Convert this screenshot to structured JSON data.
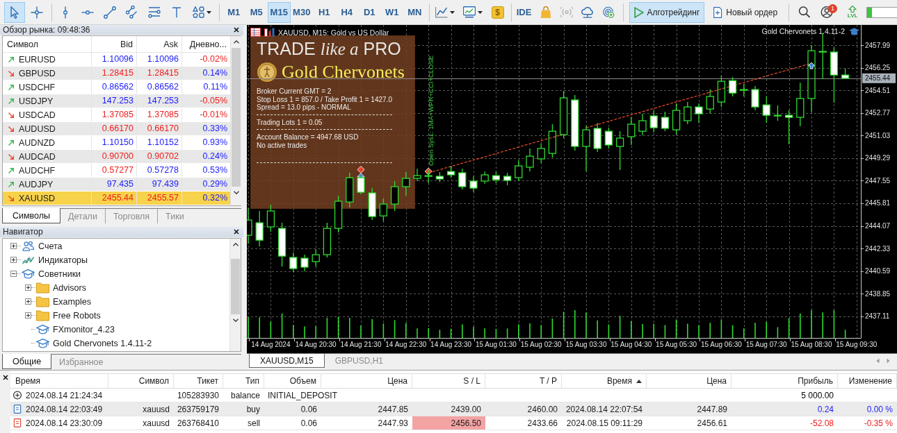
{
  "toolbar": {
    "tools": [
      {
        "kind": "cursor",
        "selected": true
      },
      {
        "kind": "crosshair",
        "selected": false
      },
      {
        "kind": "vline",
        "selected": false
      },
      {
        "kind": "hline",
        "selected": false
      },
      {
        "kind": "trendline",
        "selected": false
      },
      {
        "kind": "channel",
        "selected": false
      },
      {
        "kind": "fibo",
        "selected": false
      },
      {
        "kind": "text",
        "selected": false
      },
      {
        "kind": "shapes",
        "selected": false
      }
    ],
    "timeframes": [
      {
        "label": "M1",
        "selected": false
      },
      {
        "label": "M5",
        "selected": false
      },
      {
        "label": "M15",
        "selected": true
      },
      {
        "label": "M30",
        "selected": false
      },
      {
        "label": "H1",
        "selected": false
      },
      {
        "label": "H4",
        "selected": false
      },
      {
        "label": "D1",
        "selected": false
      },
      {
        "label": "W1",
        "selected": false
      },
      {
        "label": "MN",
        "selected": false
      }
    ],
    "actions": [
      {
        "kind": "chart_type",
        "disabled": false
      },
      {
        "kind": "indicators",
        "disabled": false
      },
      {
        "kind": "dollar",
        "label": "$",
        "disabled": false
      },
      {
        "kind": "ide",
        "label": "IDE",
        "disabled": false
      },
      {
        "kind": "market",
        "disabled": false
      },
      {
        "kind": "signals",
        "disabled": true
      },
      {
        "kind": "cloud",
        "disabled": false
      },
      {
        "kind": "radar",
        "disabled": false
      }
    ],
    "algo_button": {
      "label": "Алготрейдинг",
      "selected": true
    },
    "order_button": {
      "label": "Новый ордер"
    },
    "notifications_badge": "1",
    "level_label": "LVL",
    "level_meter": {
      "level": 0.15
    }
  },
  "market_watch": {
    "title": "Обзор рынка: 09:48:36",
    "columns": [
      "Символ",
      "Bid",
      "Ask",
      "Дневно..."
    ],
    "rows": [
      {
        "symbol": "EURUSD",
        "rising": true,
        "bid": "1.10096",
        "bid_up": true,
        "ask": "1.10096",
        "ask_up": true,
        "change": "-0.02%",
        "change_up": false,
        "selected": false
      },
      {
        "symbol": "GBPUSD",
        "rising": false,
        "bid": "1.28415",
        "bid_up": false,
        "ask": "1.28415",
        "ask_up": false,
        "change": "0.14%",
        "change_up": true,
        "selected": false
      },
      {
        "symbol": "USDCHF",
        "rising": true,
        "bid": "0.86562",
        "bid_up": true,
        "ask": "0.86562",
        "ask_up": true,
        "change": "0.11%",
        "change_up": true,
        "selected": false
      },
      {
        "symbol": "USDJPY",
        "rising": true,
        "bid": "147.253",
        "bid_up": true,
        "ask": "147.253",
        "ask_up": true,
        "change": "-0.05%",
        "change_up": false,
        "selected": false
      },
      {
        "symbol": "USDCAD",
        "rising": false,
        "bid": "1.37085",
        "bid_up": false,
        "ask": "1.37085",
        "ask_up": false,
        "change": "-0.01%",
        "change_up": false,
        "selected": false
      },
      {
        "symbol": "AUDUSD",
        "rising": false,
        "bid": "0.66170",
        "bid_up": false,
        "ask": "0.66170",
        "ask_up": false,
        "change": "0.33%",
        "change_up": true,
        "selected": false
      },
      {
        "symbol": "AUDNZD",
        "rising": true,
        "bid": "1.10150",
        "bid_up": true,
        "ask": "1.10152",
        "ask_up": true,
        "change": "0.93%",
        "change_up": true,
        "selected": false
      },
      {
        "symbol": "AUDCAD",
        "rising": false,
        "bid": "0.90700",
        "bid_up": false,
        "ask": "0.90702",
        "ask_up": false,
        "change": "0.24%",
        "change_up": true,
        "selected": false
      },
      {
        "symbol": "AUDCHF",
        "rising": true,
        "bid": "0.57277",
        "bid_up": false,
        "ask": "0.57278",
        "ask_up": true,
        "change": "0.53%",
        "change_up": true,
        "selected": false
      },
      {
        "symbol": "AUDJPY",
        "rising": true,
        "bid": "97.435",
        "bid_up": true,
        "ask": "97.439",
        "ask_up": true,
        "change": "0.29%",
        "change_up": true,
        "selected": false
      },
      {
        "symbol": "XAUUSD",
        "rising": false,
        "bid": "2455.44",
        "bid_up": false,
        "ask": "2455.57",
        "ask_up": false,
        "change": "0.32%",
        "change_up": true,
        "selected": true
      }
    ],
    "tabs": [
      {
        "label": "Символы",
        "selected": true
      },
      {
        "label": "Детали",
        "selected": false
      },
      {
        "label": "Торговля",
        "selected": false
      },
      {
        "label": "Тики",
        "selected": false
      }
    ]
  },
  "navigator": {
    "title": "Навигатор",
    "tree": [
      {
        "label": "Счета",
        "kind": "accounts",
        "expanded": false
      },
      {
        "label": "Индикаторы",
        "kind": "indicators",
        "expanded": false
      },
      {
        "label": "Советники",
        "kind": "experts",
        "expanded": true,
        "children": [
          {
            "label": "Advisors",
            "kind": "folder",
            "expanded": false
          },
          {
            "label": "Examples",
            "kind": "folder",
            "expanded": false
          },
          {
            "label": "Free Robots",
            "kind": "folder",
            "expanded": false
          },
          {
            "label": "FXmonitor_4.23",
            "kind": "expert"
          },
          {
            "label": "Gold Chervonets 1.4.11-2",
            "kind": "expert"
          }
        ]
      }
    ],
    "tabs": [
      {
        "label": "Общие",
        "selected": true
      },
      {
        "label": "Избранное",
        "selected": false
      }
    ]
  },
  "chart": {
    "title": "XAUUSD, M15: Gold vs US Dollar",
    "expert": "Gold Chervonets 1.4.11-2",
    "signal": "Open Sys1: 1MA+WPR+CCI+CLOSE",
    "ea_panel": {
      "logo": "TRADE *like a* PRO",
      "brand": "Gold Chervonets",
      "groups": [
        [
          "Broker Current GMT = 2",
          "Stop Loss 1 = 857.0 / Take Profit 1 = 1427.0",
          "Spread = 13.0 pips - NORMAL"
        ],
        [
          "Trading Lots 1 = 0.05"
        ],
        [
          "Account Balance = 4947.68 USD",
          "No active trades"
        ]
      ]
    },
    "chart_data": {
      "type": "candlestick",
      "grid": true,
      "ylim": [
        2435.44,
        2459.49
      ],
      "yticks": [
        2457.99,
        2456.25,
        2454.51,
        2452.77,
        2451.03,
        2449.29,
        2447.55,
        2445.81,
        2444.07,
        2442.33,
        2440.59,
        2438.85,
        2437.11
      ],
      "categories": [
        null,
        null,
        "14 Aug 2024",
        null,
        null,
        null,
        "14 Aug 20:30",
        null,
        null,
        null,
        "14 Aug 21:30",
        null,
        null,
        null,
        "14 Aug 22:30",
        null,
        null,
        null,
        "14 Aug 23:30",
        null,
        null,
        null,
        "15 Aug 01:30",
        null,
        null,
        null,
        "15 Aug 02:30",
        null,
        null,
        null,
        "15 Aug 03:30",
        null,
        null,
        null,
        "15 Aug 04:30",
        null,
        null,
        null,
        "15 Aug 05:30",
        null,
        null,
        null,
        "15 Aug 06:30",
        null,
        null,
        null,
        "15 Aug 07:30",
        null,
        null,
        null,
        "15 Aug 08:30",
        null,
        null,
        null,
        "15 Aug 09:30"
      ],
      "ohlc": [
        [
          2443.35,
          2445.49,
          2442.71,
          2444.52
        ],
        [
          2444.31,
          2445.22,
          2442.49,
          2442.97
        ],
        [
          2443.99,
          2445.7,
          2443.62,
          2445.22
        ],
        [
          2443.88,
          2444.31,
          2440.94,
          2441.74
        ],
        [
          2441.64,
          2442.01,
          2440.52,
          2440.78
        ],
        [
          2441.58,
          2441.85,
          2440.57,
          2440.89
        ],
        [
          2441.32,
          2442.28,
          2440.94,
          2441.85
        ],
        [
          2441.85,
          2444.31,
          2441.64,
          2443.88
        ],
        [
          2443.88,
          2446.39,
          2443.56,
          2445.97
        ],
        [
          2445.91,
          2448.16,
          2445.49,
          2447.78
        ],
        [
          2447.78,
          2447.94,
          2446.5,
          2446.66
        ],
        [
          2446.61,
          2446.98,
          2444.52,
          2444.79
        ],
        [
          2444.84,
          2446.18,
          2444.42,
          2445.75
        ],
        [
          2445.75,
          2447.52,
          2445.22,
          2447.09
        ],
        [
          2447.09,
          2448.21,
          2446.39,
          2447.73
        ],
        [
          2447.73,
          2448.48,
          2447.52,
          2447.94
        ],
        [
          2447.89,
          2448.37,
          2447.36,
          2447.94
        ],
        [
          2447.89,
          2448.21,
          2447.46,
          2447.68
        ],
        [
          2448.26,
          2448.69,
          2447.78,
          2448.0
        ],
        [
          2448.16,
          2448.48,
          2446.87,
          2447.09
        ],
        [
          2447.52,
          2447.89,
          2446.66,
          2446.98
        ],
        [
          2447.52,
          2448.26,
          2447.3,
          2448.0
        ],
        [
          2447.94,
          2448.26,
          2447.36,
          2447.62
        ],
        [
          2447.89,
          2448.16,
          2447.2,
          2447.57
        ],
        [
          2447.78,
          2449.12,
          2447.52,
          2448.69
        ],
        [
          2448.59,
          2450.03,
          2448.26,
          2449.44
        ],
        [
          2449.23,
          2450.4,
          2448.91,
          2450.03
        ],
        [
          2449.65,
          2451.9,
          2449.33,
          2451.36
        ],
        [
          2451.1,
          2454.46,
          2450.83,
          2453.93
        ],
        [
          2453.77,
          2454.14,
          2449.87,
          2450.19
        ],
        [
          2450.19,
          2451.79,
          2448.26,
          2451.47
        ],
        [
          2451.58,
          2452.0,
          2449.76,
          2450.03
        ],
        [
          2451.36,
          2451.63,
          2450.03,
          2450.3
        ],
        [
          2450.19,
          2451.36,
          2448.37,
          2450.83
        ],
        [
          2450.94,
          2452.43,
          2450.3,
          2451.9
        ],
        [
          2451.36,
          2452.7,
          2451.04,
          2452.17
        ],
        [
          2452.54,
          2452.97,
          2451.26,
          2451.63
        ],
        [
          2452.43,
          2452.86,
          2451.36,
          2451.58
        ],
        [
          2451.47,
          2453.5,
          2451.1,
          2452.97
        ],
        [
          2452.17,
          2453.61,
          2451.9,
          2453.23
        ],
        [
          2453.23,
          2453.5,
          2452.0,
          2452.7
        ],
        [
          2453.07,
          2454.57,
          2452.7,
          2454.04
        ],
        [
          2453.61,
          2455.64,
          2453.23,
          2455.21
        ],
        [
          2455.26,
          2455.53,
          2454.04,
          2454.3
        ],
        [
          2454.52,
          2455.0,
          2454.04,
          2454.57
        ],
        [
          2454.57,
          2454.84,
          2452.97,
          2453.23
        ],
        [
          2453.39,
          2454.04,
          2452.0,
          2452.59
        ],
        [
          2452.54,
          2453.34,
          2452.17,
          2452.59
        ],
        [
          2452.59,
          2452.97,
          2450.35,
          2452.43
        ],
        [
          2452.43,
          2455.1,
          2451.74,
          2453.88
        ],
        [
          2453.88,
          2457.99,
          2452.81,
          2457.56
        ],
        [
          2457.51,
          2458.9,
          2455.37,
          2457.46
        ],
        [
          2457.46,
          2457.83,
          2453.55,
          2455.69
        ],
        [
          2455.69,
          2456.17,
          2455.42,
          2455.44
        ],
        null
      ],
      "series": [
        {
          "type": "scatter",
          "color": "#3b7fe0",
          "values": [
            null,
            null,
            null,
            null,
            null,
            null,
            null,
            null,
            null,
            null,
            2447.85,
            null,
            null,
            null,
            null,
            null,
            null,
            null,
            null,
            null,
            null,
            null,
            null,
            null,
            null,
            null,
            null,
            null,
            null,
            null,
            null,
            null,
            null,
            null,
            null,
            null,
            null,
            null,
            null,
            null,
            null,
            null,
            null,
            null,
            null,
            null,
            null,
            null,
            null,
            null,
            2456.39,
            null,
            null,
            null,
            null
          ]
        },
        {
          "type": "scatter",
          "color": "#e8412c",
          "values": [
            null,
            null,
            null,
            null,
            null,
            null,
            null,
            null,
            null,
            null,
            2448.4,
            null,
            null,
            null,
            null,
            null,
            2448.26,
            null,
            null,
            null,
            null,
            null,
            null,
            null,
            null,
            null,
            null,
            null,
            null,
            null,
            null,
            null,
            null,
            null,
            null,
            null,
            null,
            null,
            null,
            null,
            null,
            null,
            null,
            null,
            null,
            null,
            null,
            null,
            null,
            null,
            null,
            null,
            null,
            null,
            null
          ]
        },
        {
          "type": "line",
          "line_style": "dashed",
          "color": "#e8502e",
          "values": [
            null,
            null,
            null,
            null,
            null,
            null,
            null,
            null,
            null,
            null,
            null,
            null,
            null,
            null,
            null,
            null,
            2448.15,
            2448.4,
            2448.65,
            2448.9,
            2449.14,
            2449.39,
            2449.64,
            2449.89,
            2450.14,
            2450.39,
            2450.64,
            2450.88,
            2451.13,
            null,
            2451.63,
            2451.88,
            2452.13,
            2452.38,
            2452.63,
            2452.87,
            2453.12,
            2453.37,
            2453.62,
            2453.87,
            2454.12,
            2454.37,
            2454.62,
            2454.86,
            2455.11,
            2455.36,
            2455.61,
            2455.86,
            2456.1,
            2456.35,
            2456.6,
            null,
            null,
            null,
            null
          ]
        }
      ],
      "ref_lines": [
        {
          "axis": "y",
          "value": 2455.44,
          "label": "2455.44"
        }
      ]
    }
  },
  "chart_tabs": [
    {
      "label": "XAUUSD,M15",
      "selected": true
    },
    {
      "label": "GBPUSD,H1",
      "selected": false
    }
  ],
  "toolbox": {
    "columns": [
      {
        "label": "Время",
        "sorted": false
      },
      {
        "label": "Символ",
        "sorted": false
      },
      {
        "label": "Тикет",
        "sorted": false
      },
      {
        "label": "Тип",
        "sorted": false
      },
      {
        "label": "Объем",
        "sorted": false
      },
      {
        "label": "Цена",
        "sorted": false
      },
      {
        "label": "S / L",
        "sorted": false
      },
      {
        "label": "T / P",
        "sorted": false
      },
      {
        "label": "Время",
        "sorted": true
      },
      {
        "label": "Цена",
        "sorted": false
      },
      {
        "label": "Прибыль",
        "sorted": false
      },
      {
        "label": "Изменение",
        "sorted": false
      }
    ],
    "rows": [
      {
        "kind": "balance",
        "time": "2024.08.14 21:24:34",
        "ticket": "105283930",
        "type": "balance",
        "comment": "INITIAL_DEPOSIT",
        "profit": "5 000.00",
        "color": "#000000"
      },
      {
        "kind": "buy",
        "time": "2024.08.14 22:03:49",
        "symbol": "xauusd",
        "ticket": "263759179",
        "type": "buy",
        "volume": "0.06",
        "price": "2447.85",
        "sl": "2439.00",
        "tp": "2460.00",
        "close_time": "2024.08.14 22:07:54",
        "close_price": "2447.89",
        "profit": "0.24",
        "change": "0.00 %",
        "color": "#1c1cff",
        "sl_alert": false
      },
      {
        "kind": "sell",
        "time": "2024.08.14 23:30:09",
        "symbol": "xauusd",
        "ticket": "263768410",
        "type": "sell",
        "volume": "0.06",
        "price": "2447.93",
        "sl": "2456.50",
        "tp": "2433.66",
        "close_time": "2024.08.15 09:11:29",
        "close_price": "2456.61",
        "profit": "-52.08",
        "change": "-0.35 %",
        "color": "#f01c1c",
        "sl_alert": true
      }
    ]
  }
}
